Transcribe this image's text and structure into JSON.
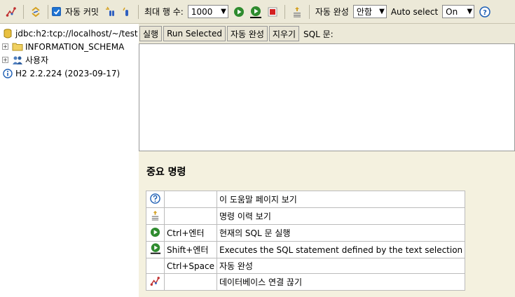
{
  "toolbar": {
    "autocommit_label": "자동 커밋",
    "max_rows_label": "최대 행 수:",
    "max_rows_value": "1000",
    "autocomplete_label": "자동 완성",
    "autocomplete_value": "안함",
    "autoselect_label": "Auto select",
    "autoselect_value": "On",
    "help_glyph": "?"
  },
  "tree": {
    "connection": "jdbc:h2:tcp://localhost/~/test",
    "schema": "INFORMATION_SCHEMA",
    "users": "사용자",
    "version": "H2 2.2.224 (2023-09-17)"
  },
  "query": {
    "run_label": "실행",
    "run_selected_label": "Run Selected",
    "autocomplete_label": "자동 완성",
    "clear_label": "지우기",
    "sql_label": "SQL 문:",
    "sql_text": ""
  },
  "help": {
    "title": "중요 명령",
    "rows": [
      {
        "icon": "help-icon",
        "key": "",
        "desc": "이 도움말 페이지 보기"
      },
      {
        "icon": "history-icon",
        "key": "",
        "desc": "명령 이력 보기"
      },
      {
        "icon": "run-icon",
        "key": "Ctrl+엔터",
        "desc": "현재의 SQL 문 실행"
      },
      {
        "icon": "run-selected-icon",
        "key": "Shift+엔터",
        "desc": "Executes the SQL statement defined by the text selection"
      },
      {
        "icon": "",
        "key": "Ctrl+Space",
        "desc": "자동 완성"
      },
      {
        "icon": "disconnect-icon",
        "key": "",
        "desc": "데이터베이스 연결 끊기"
      }
    ]
  },
  "colors": {
    "toolbar_bg": "#ece9d8",
    "help_bg": "#f4f1df",
    "run_green": "#2e8b2e",
    "stop_red": "#d42020",
    "help_blue": "#1e5fb4"
  }
}
